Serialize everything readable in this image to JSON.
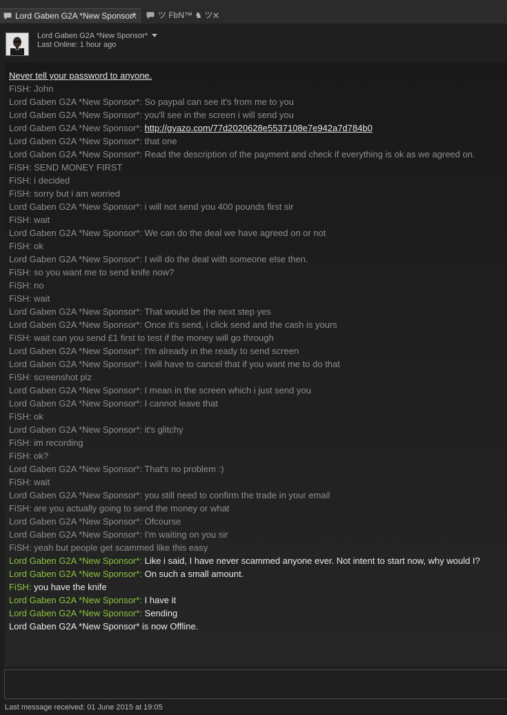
{
  "tabs": [
    {
      "label": "Lord Gaben G2A *New Sponsor*",
      "close": "✕",
      "icon": "chat-bubble-icon",
      "active": true
    },
    {
      "label": "ツ FbN™ ♞ ツ",
      "close": "✕",
      "icon": "chat-bubble-icon",
      "active": false
    }
  ],
  "header": {
    "friend_name": "Lord Gaben G2A *New Sponsor*",
    "status": "Last Online: 1 hour ago"
  },
  "chat": {
    "warning": "Never tell your password to anyone.",
    "messages": [
      {
        "sender": "FiSH",
        "text": "John",
        "style": "old"
      },
      {
        "sender": "Lord Gaben G2A *New Sponsor*",
        "text": "So paypal can see it's from me to you",
        "style": "old"
      },
      {
        "sender": "Lord Gaben G2A *New Sponsor*",
        "text": "you'll see in the screen i will send you",
        "style": "old"
      },
      {
        "sender": "Lord Gaben G2A *New Sponsor*",
        "text": "http://gyazo.com/77d2020628e5537108e7e942a7d784b0",
        "style": "old",
        "link": true
      },
      {
        "sender": "Lord Gaben G2A *New Sponsor*",
        "text": "that one",
        "style": "old"
      },
      {
        "sender": "Lord Gaben G2A *New Sponsor*",
        "text": "Read the description of the payment and check if everything is ok as we agreed on.",
        "style": "old"
      },
      {
        "sender": "FiSH",
        "text": "SEND MONEY FIRST",
        "style": "old"
      },
      {
        "sender": "FiSH",
        "text": "i decided",
        "style": "old"
      },
      {
        "sender": "FiSH",
        "text": "sorry but i am worried",
        "style": "old"
      },
      {
        "sender": "Lord Gaben G2A *New Sponsor*",
        "text": "i will not send you 400 pounds first sir",
        "style": "old"
      },
      {
        "sender": "FiSH",
        "text": "wait",
        "style": "old"
      },
      {
        "sender": "Lord Gaben G2A *New Sponsor*",
        "text": "We can do the deal we have agreed on or not",
        "style": "old"
      },
      {
        "sender": "FiSH",
        "text": "ok",
        "style": "old"
      },
      {
        "sender": "Lord Gaben G2A *New Sponsor*",
        "text": "I will do the deal with someone else then.",
        "style": "old"
      },
      {
        "sender": "FiSH",
        "text": "so you want me to send knife now?",
        "style": "old"
      },
      {
        "sender": "FiSH",
        "text": "no",
        "style": "old"
      },
      {
        "sender": "FiSH",
        "text": "wait",
        "style": "old"
      },
      {
        "sender": "Lord Gaben G2A *New Sponsor*",
        "text": "That would be the next step yes",
        "style": "old"
      },
      {
        "sender": "Lord Gaben G2A *New Sponsor*",
        "text": "Once it's send, i click send and the cash is yours",
        "style": "old"
      },
      {
        "sender": "FiSH",
        "text": "wait can you send £1 first to test if the money will go through",
        "style": "old"
      },
      {
        "sender": "Lord Gaben G2A *New Sponsor*",
        "text": "I'm already in the ready to send screen",
        "style": "old"
      },
      {
        "sender": "Lord Gaben G2A *New Sponsor*",
        "text": "I will have to cancel that if you want me to do that",
        "style": "old"
      },
      {
        "sender": "FiSH",
        "text": "screenshot plz",
        "style": "old"
      },
      {
        "sender": "Lord Gaben G2A *New Sponsor*",
        "text": "I mean in the screen which i just send you",
        "style": "old"
      },
      {
        "sender": "Lord Gaben G2A *New Sponsor*",
        "text": "I cannot leave that",
        "style": "old"
      },
      {
        "sender": "FiSH",
        "text": "ok",
        "style": "old"
      },
      {
        "sender": "Lord Gaben G2A *New Sponsor*",
        "text": "it's glitchy",
        "style": "old"
      },
      {
        "sender": "FiSH",
        "text": "im recording",
        "style": "old"
      },
      {
        "sender": "FiSH",
        "text": "ok?",
        "style": "old"
      },
      {
        "sender": "Lord Gaben G2A *New Sponsor*",
        "text": "That's no problem :)",
        "style": "old"
      },
      {
        "sender": "FiSH",
        "text": "wait",
        "style": "old"
      },
      {
        "sender": "Lord Gaben G2A *New Sponsor*",
        "text": "you still need to confirm the trade in your email",
        "style": "old"
      },
      {
        "sender": "FiSH",
        "text": "are you actually going to send the money or what",
        "style": "old"
      },
      {
        "sender": "Lord Gaben G2A *New Sponsor*",
        "text": "Ofcourse",
        "style": "old"
      },
      {
        "sender": "Lord Gaben G2A *New Sponsor*",
        "text": "I'm waiting on you sir",
        "style": "old"
      },
      {
        "sender": "FiSH",
        "text": "yeah but people get scammed like this easy",
        "style": "old"
      },
      {
        "sender": "Lord Gaben G2A *New Sponsor*",
        "text": "Like i said, I have never scammed anyone ever. Not intent to start now, why would I?",
        "style": "new"
      },
      {
        "sender": "Lord Gaben G2A *New Sponsor*",
        "text": "On such a small amount.",
        "style": "new"
      },
      {
        "sender": "FiSH",
        "text": "you have the knife",
        "style": "new"
      },
      {
        "sender": "Lord Gaben G2A *New Sponsor*",
        "text": "I have it",
        "style": "new"
      },
      {
        "sender": "Lord Gaben G2A *New Sponsor*",
        "text": "Sending",
        "style": "new"
      }
    ],
    "system_message": "Lord Gaben G2A *New Sponsor* is now Offline."
  },
  "input": {
    "value": ""
  },
  "footer": {
    "last_received": "Last message received: 01 June 2015 at 19:05"
  },
  "colors": {
    "old_message": "#8e8e8e",
    "new_sender": "#8bc53f",
    "new_text": "#ececec"
  }
}
